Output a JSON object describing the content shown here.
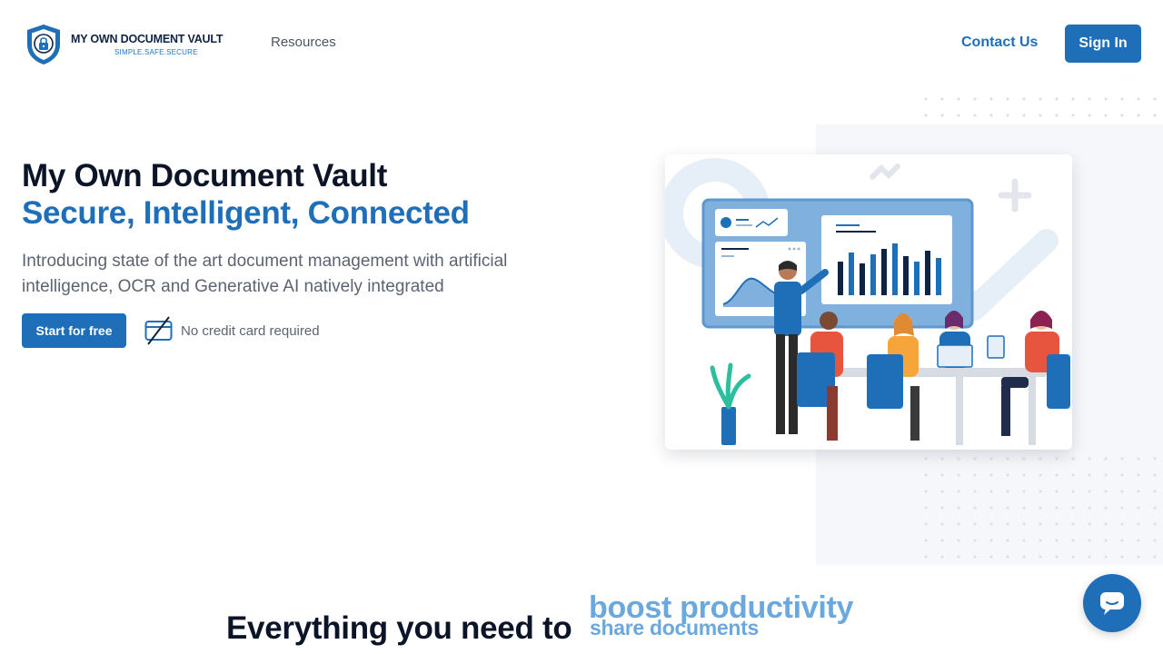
{
  "brand": {
    "name": "MY OWN DOCUMENT VAULT",
    "tagline": "SIMPLE.SAFE.SECURE",
    "logo_icon": "shield-lock-logo"
  },
  "nav": {
    "resources": "Resources",
    "contact": "Contact Us",
    "signin": "Sign In"
  },
  "hero": {
    "title": "My Own Document Vault",
    "subtitle": "Secure, Intelligent, Connected",
    "description": "Introducing state of the art document management with artificial intelligence, OCR and Generative AI natively integrated",
    "cta": "Start for free",
    "no_card_icon": "no-credit-card-icon",
    "no_card_text": "No credit card required"
  },
  "illustration": {
    "icon": "team-meeting-presentation-illustration"
  },
  "features": {
    "lead": "Everything you need to",
    "rotating": [
      "boost productivity",
      "share documents"
    ]
  },
  "chat": {
    "icon": "chat-bubble-icon"
  },
  "colors": {
    "primary": "#1f6fb8",
    "heading": "#0b1527",
    "muted": "#5b6470",
    "accent_light": "#6aa8dd"
  }
}
